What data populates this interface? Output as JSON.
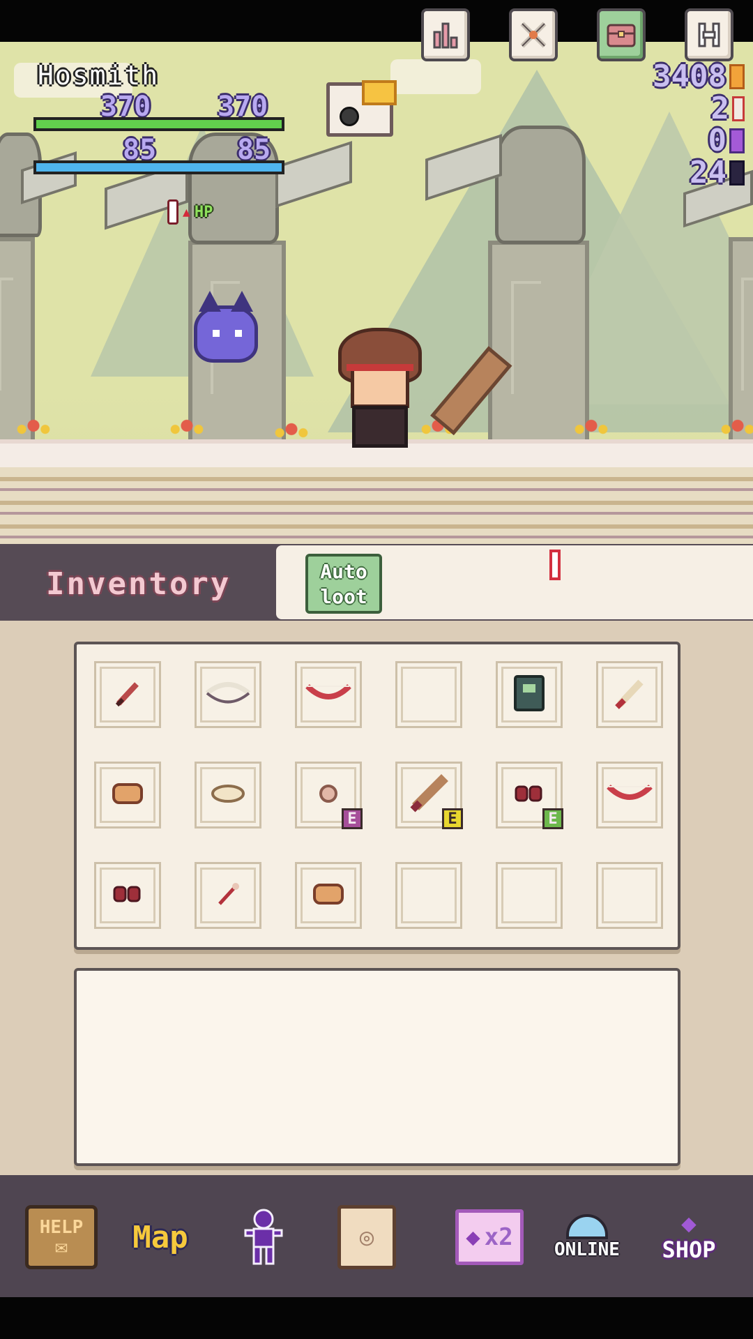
{
  "player": {
    "name": "Hosmith",
    "hp_current": "370",
    "hp_max": "370",
    "mp_current": "85",
    "mp_max": "85",
    "hp_fill": 1.0,
    "mp_fill": 1.0,
    "hp_color": "#62d04d",
    "mp_color": "#4fb5ee",
    "potion_label": "HP"
  },
  "resources": {
    "gold": "3408",
    "rockets": "2",
    "gems": "0",
    "souls": "24"
  },
  "inventory": {
    "title": "Inventory",
    "auto_loot_line1": "Auto",
    "auto_loot_line2": "loot",
    "toolbar_icons": [
      "sort-icon",
      "crossed-swords-icon",
      "chest-icon",
      "h-icon"
    ],
    "equipped_badge": "E",
    "slots": [
      {
        "icon": "red-dagger-icon",
        "equipped": false
      },
      {
        "icon": "bone-bow-icon",
        "equipped": false
      },
      {
        "icon": "red-bow-icon",
        "equipped": false
      },
      {
        "icon": "",
        "equipped": false
      },
      {
        "icon": "green-spellbook-icon",
        "equipped": false
      },
      {
        "icon": "jeweled-dagger-icon",
        "equipped": false
      },
      {
        "icon": "leather-armor-icon",
        "equipped": false
      },
      {
        "icon": "cloth-cap-icon",
        "equipped": false
      },
      {
        "icon": "ring-icon",
        "equipped": true,
        "badge_color": "#a64f9a"
      },
      {
        "icon": "wooden-sword-icon",
        "equipped": true,
        "badge_color": "#e8d62f"
      },
      {
        "icon": "red-gloves-icon",
        "equipped": true,
        "badge_color": "#6db84c"
      },
      {
        "icon": "red-bow-icon",
        "equipped": false
      },
      {
        "icon": "red-gloves-icon",
        "equipped": false
      },
      {
        "icon": "wand-icon",
        "equipped": false
      },
      {
        "icon": "leather-armor-icon",
        "equipped": false
      },
      {
        "icon": "",
        "equipped": false
      },
      {
        "icon": "",
        "equipped": false
      },
      {
        "icon": "",
        "equipped": false
      }
    ]
  },
  "nav": {
    "help_label": "HELP",
    "map_label": "Map",
    "gems_label": "x2",
    "online_label": "ONLINE",
    "shop_label": "SHOP",
    "icons": [
      "help-mail-icon",
      "map-icon",
      "character-icon",
      "quest-scroll-icon",
      "gem-x2-icon",
      "online-globe-icon",
      "shop-crystal-icon"
    ]
  }
}
